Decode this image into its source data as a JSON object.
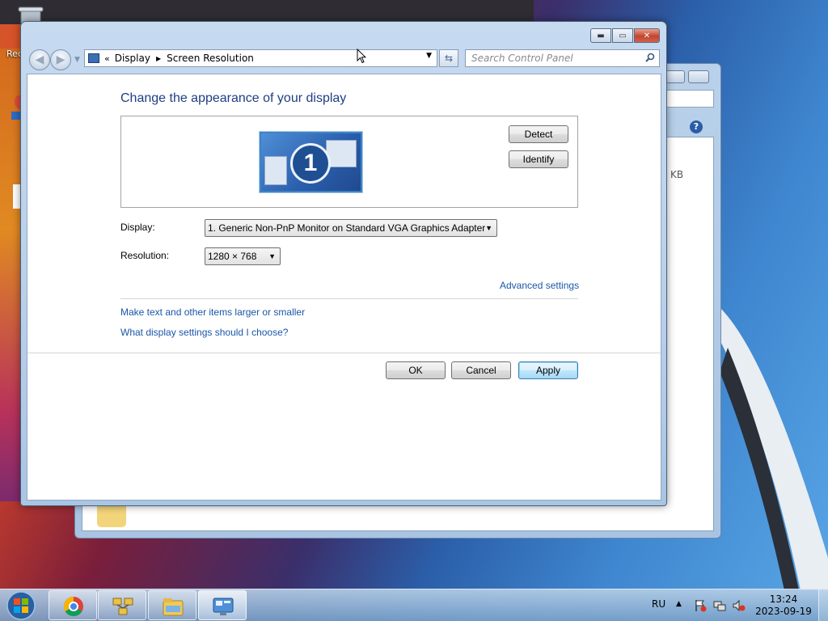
{
  "desktop": {
    "recycle_label": "Rec",
    "icon_label": "C"
  },
  "bg_window": {
    "size_text": "KB"
  },
  "window": {
    "breadcrumb": [
      "Display",
      "Screen Resolution"
    ],
    "search_placeholder": "Search Control Panel",
    "caption": {
      "minimize": "minimize-icon",
      "maximize": "maximize-icon",
      "close": "close-icon"
    }
  },
  "main": {
    "heading": "Change the appearance of your display",
    "monitor_number": "1",
    "detect_label": "Detect",
    "identify_label": "Identify",
    "display_label": "Display:",
    "display_value": "1. Generic Non-PnP Monitor on Standard VGA Graphics Adapter",
    "resolution_label": "Resolution:",
    "resolution_value": "1280 × 768",
    "advanced_link": "Advanced settings",
    "links": [
      "Make text and other items larger or smaller",
      "What display settings should I choose?"
    ],
    "ok_label": "OK",
    "cancel_label": "Cancel",
    "apply_label": "Apply"
  },
  "taskbar": {
    "items": [
      "chrome-icon",
      "network-icon",
      "explorer-icon",
      "control-panel-icon"
    ],
    "language": "RU",
    "time": "13:24",
    "date": "2023-09-19"
  },
  "colors": {
    "link": "#1a56a8",
    "heading": "#1e3e82",
    "close_red": "#c4452f"
  }
}
